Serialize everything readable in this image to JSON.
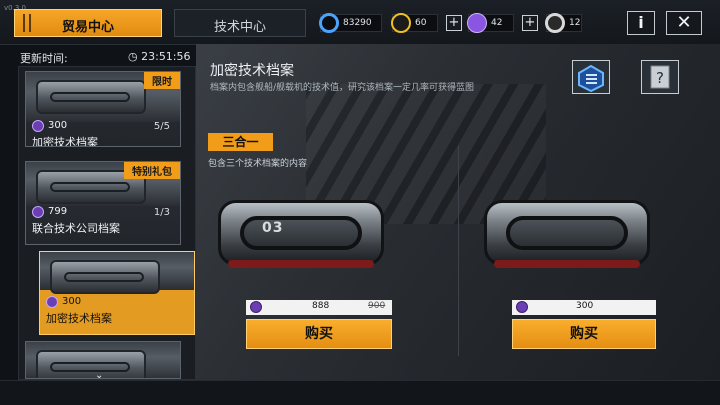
{
  "version": "v0.3.0",
  "tabs": {
    "trade": "贸易中心",
    "tech": "技术中心"
  },
  "resources": [
    {
      "name": "credits",
      "value": "83290",
      "color": "#4aa3ff"
    },
    {
      "name": "gold",
      "value": "60",
      "color": "#f0c020"
    },
    {
      "name": "premium",
      "value": "42",
      "color": "#8a55e0"
    },
    {
      "name": "pass",
      "value": "12",
      "color": "#d9d9d9"
    }
  ],
  "top_buttons": {
    "info": "i",
    "close": "✕"
  },
  "left": {
    "update_label": "更新时间:",
    "timer": "23:51:56",
    "items": [
      {
        "tag": "限时",
        "price": "300",
        "count": "5/5",
        "name": "加密技术档案"
      },
      {
        "tag": "特别礼包",
        "price": "799",
        "count": "1/3",
        "name": "联合技术公司档案"
      },
      {
        "tag": "",
        "price": "300",
        "count": "",
        "name": "加密技术档案"
      },
      {
        "tag": "",
        "price": "",
        "count": "",
        "name": ""
      }
    ]
  },
  "main": {
    "title": "加密技术档案",
    "desc": "档案内包含舰船/舰载机的技术值，研究该档案一定几率可获得蓝图",
    "bundle_label": "三合一",
    "bundle_desc": "包含三个技术档案的内容",
    "offers": [
      {
        "crate_label": "03",
        "price": "888",
        "old_price": "900",
        "buy": "购买"
      },
      {
        "crate_label": "",
        "price": "300",
        "old_price": "",
        "buy": "购买"
      }
    ]
  },
  "colors": {
    "accent": "#f29d19",
    "premium": "#6b3fb3"
  }
}
